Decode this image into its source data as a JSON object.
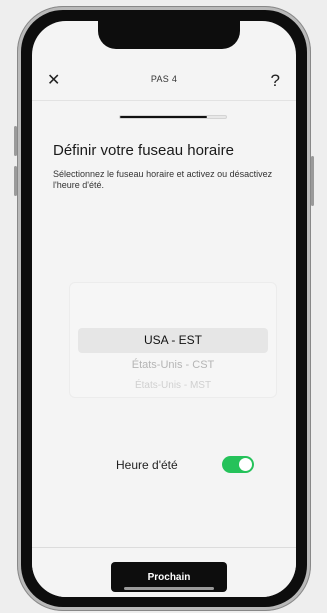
{
  "header": {
    "close_icon": "✕",
    "step_label": "PAS 4",
    "help_icon": "?"
  },
  "progress": {
    "fraction": 0.82
  },
  "content": {
    "title": "Définir votre fuseau horaire",
    "subtitle": "Sélectionnez le fuseau horaire et activez ou désactivez l'heure d'été."
  },
  "timezone_picker": {
    "options": [
      "USA - EST",
      "États-Unis - CST",
      "États-Unis - MST"
    ],
    "selected_index": 0
  },
  "dst": {
    "label": "Heure d'été",
    "enabled": true
  },
  "footer": {
    "next_label": "Prochain"
  },
  "colors": {
    "accent": "#25c25a",
    "button_bg": "#0d0d0d",
    "screen_bg": "#f4f4f4"
  }
}
